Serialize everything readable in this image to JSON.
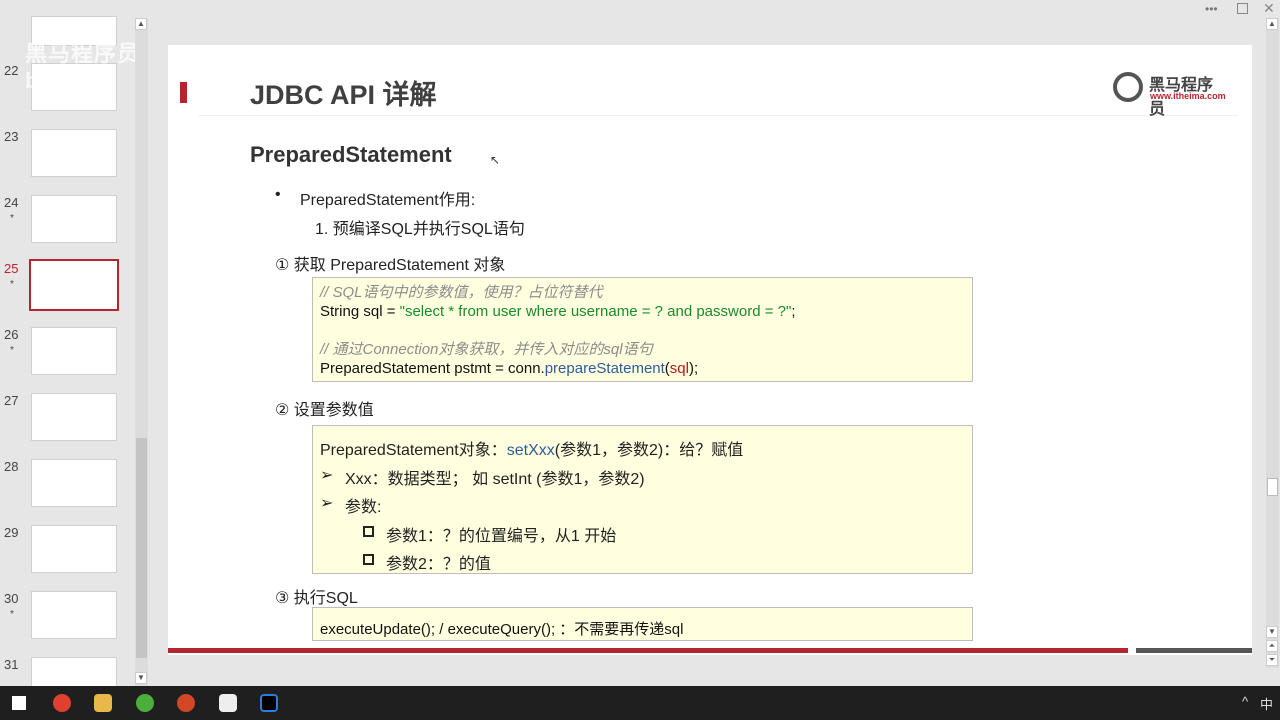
{
  "thumbnails": [
    {
      "num": "22",
      "star": false
    },
    {
      "num": "23",
      "star": false
    },
    {
      "num": "24",
      "star": true
    },
    {
      "num": "25",
      "star": true,
      "active": true
    },
    {
      "num": "26",
      "star": true
    },
    {
      "num": "27",
      "star": false
    },
    {
      "num": "28",
      "star": false
    },
    {
      "num": "29",
      "star": false
    },
    {
      "num": "30",
      "star": true
    },
    {
      "num": "31",
      "star": false
    }
  ],
  "star_symbol": "*",
  "slide": {
    "title": "JDBC API 详解",
    "logo_cn": "黑马程序员",
    "logo_url": "www.itheima.com",
    "subtitle": "PreparedStatement",
    "bullet": "PreparedStatement作用:",
    "numbered": "1.   预编译SQL并执行SQL语句",
    "step1": "①   获取 PreparedStatement 对象",
    "code1": {
      "comment1": "// SQL语句中的参数值，使用？占位符替代",
      "line1_a": "String sql = ",
      "line1_str": "\"select * from user where username = ? and password = ?\"",
      "line1_end": ";",
      "comment2": "// 通过Connection对象获取，并传入对应的sql语句",
      "line2_a": "PreparedStatement pstmt = conn.",
      "line2_m": "prepareStatement",
      "line2_p1": "(",
      "line2_arg": "sql",
      "line2_end": ");"
    },
    "step2": "②   设置参数值",
    "code2": {
      "l1_a": "PreparedStatement对象：",
      "l1_m": "setXxx",
      "l1_b": "(参数1，参数2)：给？赋值",
      "l2": "Xxx：数据类型； 如 setInt (参数1，参数2)",
      "l3": "参数:",
      "l4": "参数1：？的位置编号，从1 开始",
      "l5": "参数2：？的值"
    },
    "step3": "③   执行SQL",
    "code3": "executeUpdate(); / executeQuery(); ：不需要再传递sql"
  },
  "watermark": "黑马程序员 bilibili",
  "taskbar": {
    "ime": "中",
    "tray_arrow": "^"
  },
  "colors": {
    "accent": "#b4262d",
    "code_bg": "#ffffe0"
  }
}
